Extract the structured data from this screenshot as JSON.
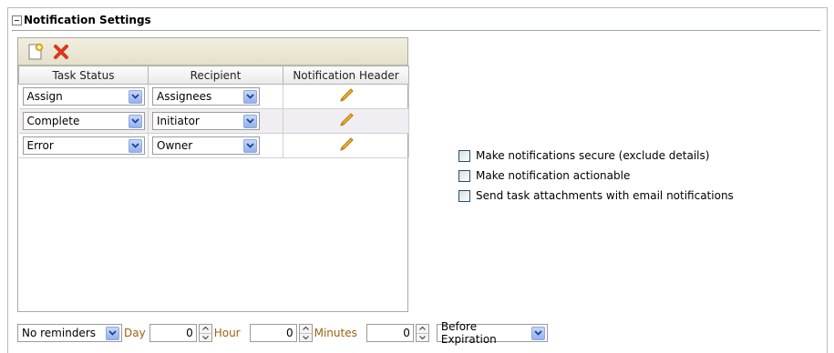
{
  "section": {
    "title": "Notification Settings"
  },
  "table": {
    "columns": [
      "Task Status",
      "Recipient",
      "Notification Header"
    ],
    "rows": [
      {
        "status": "Assign",
        "recipient": "Assignees"
      },
      {
        "status": "Complete",
        "recipient": "Initiator"
      },
      {
        "status": "Error",
        "recipient": "Owner"
      }
    ]
  },
  "options": [
    {
      "label": "Make notifications secure (exclude details)",
      "checked": false
    },
    {
      "label": "Make notification actionable",
      "checked": false
    },
    {
      "label": "Send task attachments with email notifications",
      "checked": false
    }
  ],
  "reminder": {
    "selected": "No reminders",
    "day_label": "Day",
    "day_value": "0",
    "hour_label": "Hour",
    "hour_value": "0",
    "minutes_label": "Minutes",
    "minutes_value": "0",
    "relative_selected": "Before Expiration"
  },
  "icons": {
    "add": "add-document-icon",
    "delete": "delete-x-icon",
    "edit": "pencil-icon",
    "dropdown": "chevron-down-icon"
  },
  "colors": {
    "delete_red": "#d9381e",
    "unit_label": "#a06010",
    "toolbar_bg": "#ece6d3",
    "alt_row": "#f0eef3"
  }
}
